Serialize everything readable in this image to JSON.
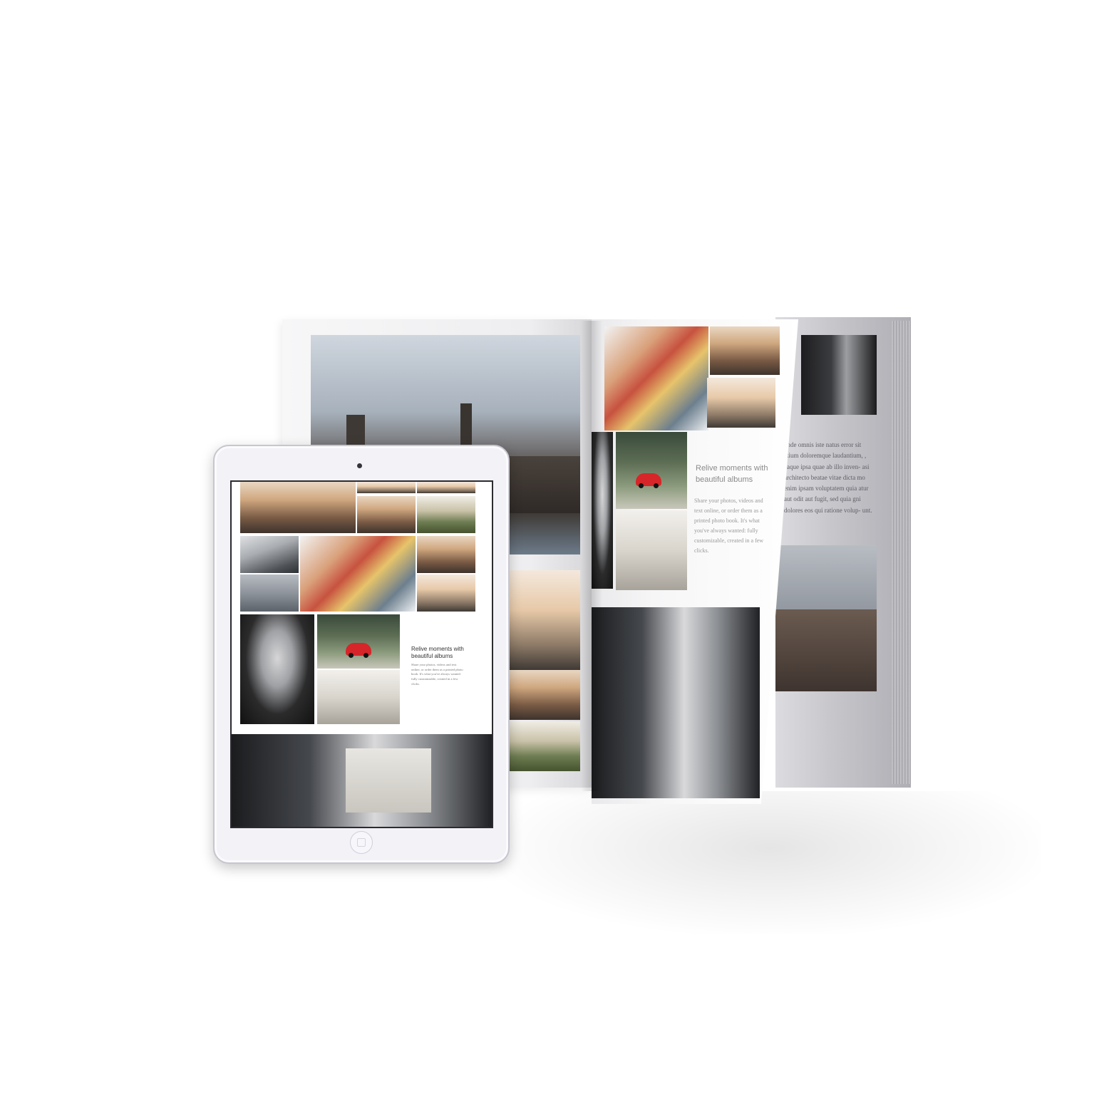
{
  "book": {
    "page_heading": "Relive moments with beautiful albums",
    "page_body": "Share your photos, videos and text online, or order them as a printed photo book. It's what you've always wanted: fully customizable, created in a few clicks.",
    "under_page_text": "unde omnis iste natus error sit atium doloremque laudantium, , eaque ipsa quae ab illo inven- asi architecto beatae vitae dicta mo enim ipsam voluptatem quia atur aut odit aut fugit, sed quia gni dolores eos qui ratione volup- unt."
  },
  "tablet": {
    "heading": "Relive moments with beautiful albums",
    "body": "Share your photos, videos and text online, or order them as a printed photo book. It's what you've always wanted: fully customizable, created in a few clicks."
  },
  "colors": {
    "background": "#ffffff",
    "tablet_frame": "#f3f2f7",
    "car_red": "#d6262a"
  }
}
